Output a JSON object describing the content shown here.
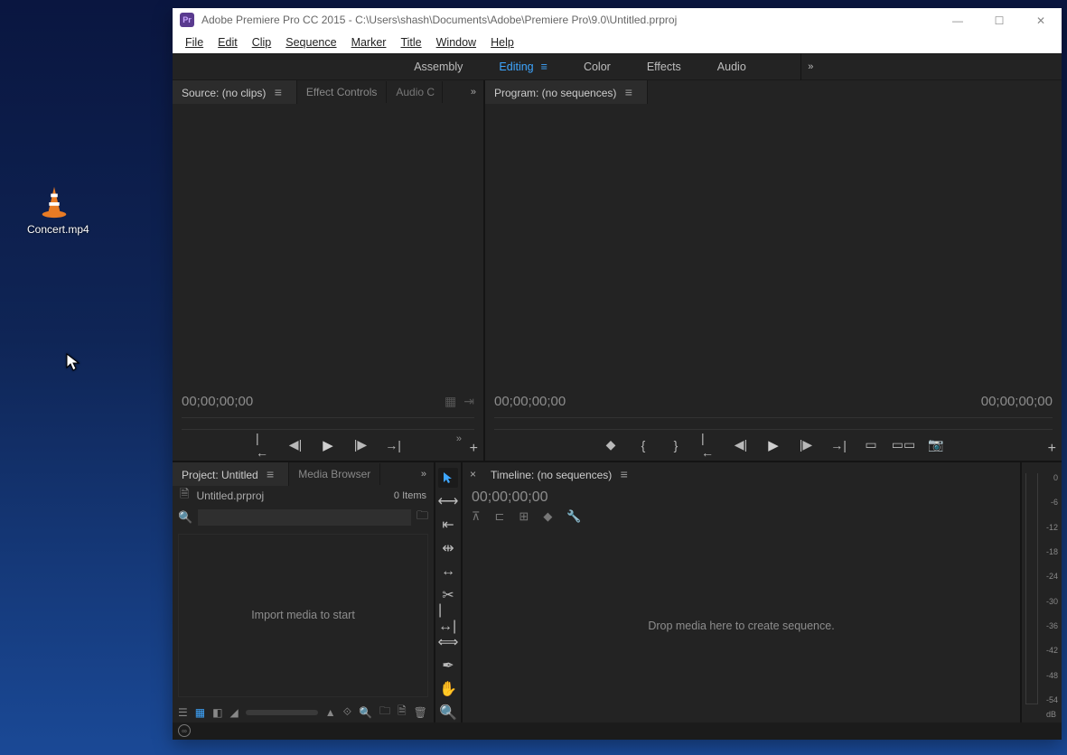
{
  "desktop": {
    "file_label": "Concert.mp4"
  },
  "titlebar": {
    "app": "Pr",
    "title": "Adobe Premiere Pro CC 2015 - C:\\Users\\shash\\Documents\\Adobe\\Premiere Pro\\9.0\\Untitled.prproj"
  },
  "menu": {
    "file": "File",
    "edit": "Edit",
    "clip": "Clip",
    "sequence": "Sequence",
    "marker": "Marker",
    "title": "Title",
    "window": "Window",
    "help": "Help"
  },
  "workspaces": {
    "assembly": "Assembly",
    "editing": "Editing",
    "color": "Color",
    "effects": "Effects",
    "audio": "Audio"
  },
  "source": {
    "tab_source": "Source: (no clips)",
    "tab_effect": "Effect Controls",
    "tab_audio": "Audio C",
    "timecode": "00;00;00;00"
  },
  "program": {
    "tab_program": "Program: (no sequences)",
    "timecode_left": "00;00;00;00",
    "timecode_right": "00;00;00;00"
  },
  "project": {
    "tab_project": "Project: Untitled",
    "tab_media": "Media Browser",
    "filename": "Untitled.prproj",
    "items": "0 Items",
    "import_msg": "Import media to start"
  },
  "timeline": {
    "tab": "Timeline: (no sequences)",
    "timecode": "00;00;00;00",
    "drop_msg": "Drop media here to create sequence."
  },
  "meters": {
    "labels": [
      "0",
      "-6",
      "-12",
      "-18",
      "-24",
      "-30",
      "-36",
      "-42",
      "-48",
      "-54"
    ],
    "unit": "dB"
  }
}
